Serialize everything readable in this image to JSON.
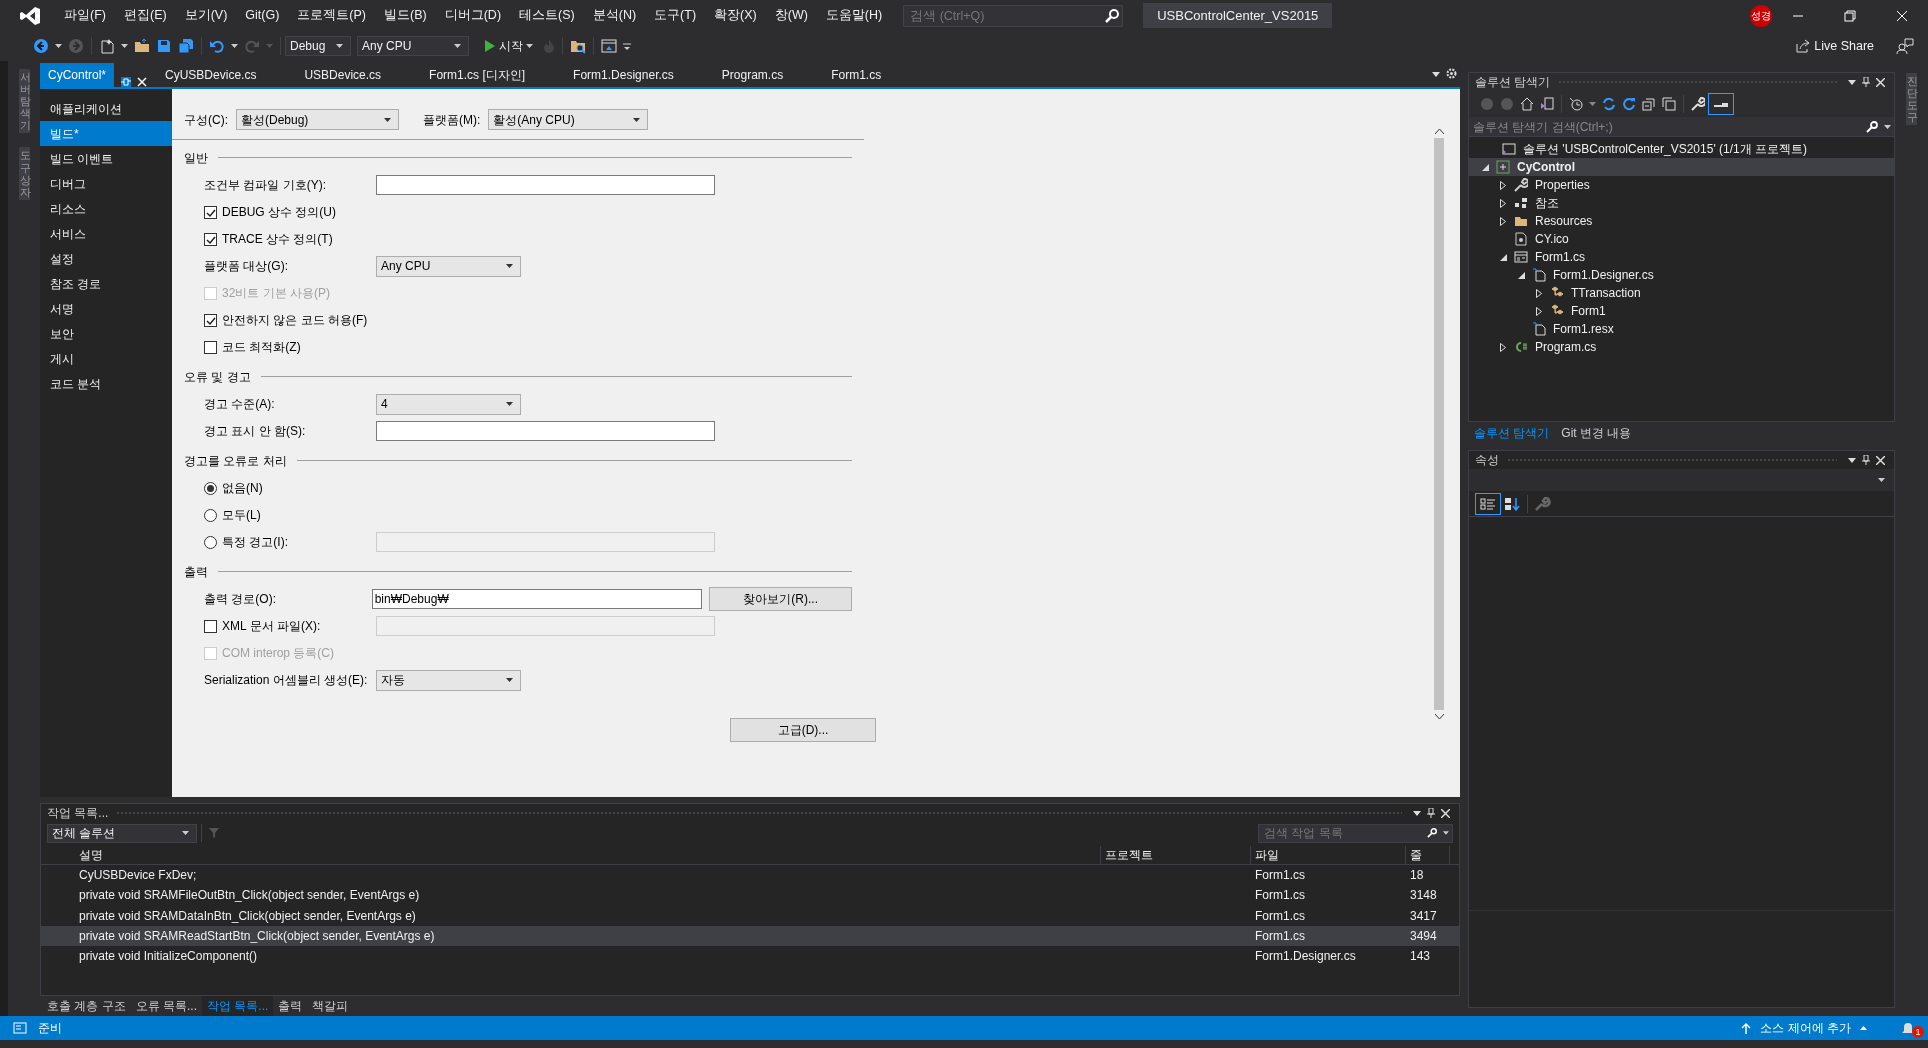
{
  "menu": [
    "파일(F)",
    "편집(E)",
    "보기(V)",
    "Git(G)",
    "프로젝트(P)",
    "빌드(B)",
    "디버그(D)",
    "테스트(S)",
    "분석(N)",
    "도구(T)",
    "확장(X)",
    "창(W)",
    "도움말(H)"
  ],
  "search": {
    "placeholder": "검색 (Ctrl+Q)"
  },
  "solution_name": "USBControlCenter_VS2015",
  "user_badge": "성경",
  "toolbar": {
    "configuration": "Debug",
    "platform": "Any CPU",
    "start": "시작"
  },
  "live_share": "Live Share",
  "tabs": [
    {
      "label": "CyControl*",
      "selected": true
    },
    {
      "label": "CyUSBDevice.cs",
      "selected": false
    },
    {
      "label": "USBDevice.cs",
      "selected": false
    },
    {
      "label": "Form1.cs [디자인]",
      "selected": false
    },
    {
      "label": "Form1.Designer.cs",
      "selected": false
    },
    {
      "label": "Program.cs",
      "selected": false
    },
    {
      "label": "Form1.cs",
      "selected": false
    }
  ],
  "left_strip": [
    "서버 탐색기",
    "도구 상자"
  ],
  "right_strip": [
    "진단 도구"
  ],
  "nav": [
    {
      "label": "애플리케이션",
      "selected": false
    },
    {
      "label": "빌드*",
      "selected": true
    },
    {
      "label": "빌드 이벤트",
      "selected": false
    },
    {
      "label": "디버그",
      "selected": false
    },
    {
      "label": "리소스",
      "selected": false
    },
    {
      "label": "서비스",
      "selected": false
    },
    {
      "label": "설정",
      "selected": false
    },
    {
      "label": "참조 경로",
      "selected": false
    },
    {
      "label": "서명",
      "selected": false
    },
    {
      "label": "보안",
      "selected": false
    },
    {
      "label": "게시",
      "selected": false
    },
    {
      "label": "코드 분석",
      "selected": false
    }
  ],
  "build": {
    "configuration": {
      "label": "구성(C):",
      "value": "활성(Debug)"
    },
    "platform": {
      "label": "플랫폼(M):",
      "value": "활성(Any CPU)"
    },
    "sections": [
      {
        "title": "일반",
        "rows": [
          {
            "kind": "field",
            "label": "조건부 컴파일 기호(Y):",
            "disabled": false
          },
          {
            "kind": "check",
            "label": "DEBUG 상수 정의(U)",
            "checked": true,
            "disabled": false
          },
          {
            "kind": "check",
            "label": "TRACE 상수 정의(T)",
            "checked": true,
            "disabled": false
          },
          {
            "kind": "select",
            "label": "플랫폼 대상(G):",
            "value": "Any CPU"
          },
          {
            "kind": "check",
            "label": "32비트 기본 사용(P)",
            "checked": false,
            "disabled": true
          },
          {
            "kind": "check",
            "label": "안전하지 않은 코드 허용(F)",
            "checked": true,
            "disabled": false
          },
          {
            "kind": "check",
            "label": "코드 최적화(Z)",
            "checked": false,
            "disabled": false
          }
        ]
      },
      {
        "title": "오류 및 경고",
        "rows": [
          {
            "kind": "select",
            "label": "경고 수준(A):",
            "value": "4"
          },
          {
            "kind": "field",
            "label": "경고 표시 안 함(S):",
            "disabled": false
          }
        ]
      },
      {
        "title": "경고를 오류로 처리",
        "rows": [
          {
            "kind": "radio",
            "label": "없음(N)",
            "selected": true
          },
          {
            "kind": "radio",
            "label": "모두(L)",
            "selected": false
          },
          {
            "kind": "radio",
            "label": "특정 경고(I):",
            "selected": false,
            "field": {
              "disabled": true
            }
          }
        ]
      },
      {
        "title": "출력",
        "rows": [
          {
            "kind": "field",
            "label": "출력 경로(O):",
            "value": "bin₩Debug₩",
            "disabled": false,
            "button": "찾아보기(R)..."
          },
          {
            "kind": "check",
            "label": "XML 문서 파일(X):",
            "checked": false,
            "disabled": false,
            "field": {
              "disabled": true
            }
          },
          {
            "kind": "check",
            "label": "COM interop 등록(C)",
            "checked": false,
            "disabled": true
          },
          {
            "kind": "select",
            "label": "Serialization 어셈블리 생성(E):",
            "value": "자동"
          }
        ]
      }
    ],
    "advanced_button": "고급(D)..."
  },
  "solution_explorer": {
    "title": "솔루션 탐색기",
    "search_placeholder": "솔루션 탐색기 검색(Ctrl+;)",
    "preview_on": true,
    "tree": [
      {
        "label": "솔루션 'USBControlCenter_VS2015' (1/1개 프로젝트)",
        "kind": "solution",
        "selected": false,
        "children": [
          {
            "label": "CyControl",
            "kind": "project",
            "expanded": true,
            "selected": true,
            "children": [
              {
                "label": "Properties",
                "kind": "wrench",
                "expanded": false,
                "selected": false
              },
              {
                "label": "참조",
                "kind": "references",
                "expanded": false,
                "selected": false
              },
              {
                "label": "Resources",
                "kind": "folder",
                "expanded": false,
                "selected": false
              },
              {
                "label": "CY.ico",
                "kind": "file",
                "selected": false
              },
              {
                "label": "Form1.cs",
                "kind": "form",
                "expanded": true,
                "selected": false,
                "children": [
                  {
                    "label": "Form1.Designer.cs",
                    "kind": "designer",
                    "expanded": true,
                    "selected": false,
                    "children": [
                      {
                        "label": "TTransaction",
                        "kind": "class",
                        "expanded": false,
                        "selected": false
                      },
                      {
                        "label": "Form1",
                        "kind": "class",
                        "expanded": false,
                        "selected": false
                      }
                    ]
                  },
                  {
                    "label": "Form1.resx",
                    "kind": "designer",
                    "selected": false
                  }
                ]
              },
              {
                "label": "Program.cs",
                "kind": "csharp",
                "expanded": false,
                "selected": false
              }
            ]
          }
        ]
      }
    ],
    "tabs": [
      {
        "label": "솔루션 탐색기",
        "selected": true
      },
      {
        "label": "Git 변경 내용",
        "selected": false
      }
    ]
  },
  "properties": {
    "title": "속성",
    "categorized_on": true
  },
  "task_list": {
    "title": "작업 목록...",
    "scope": "전체 솔루션",
    "search_placeholder": "검색 작업 목록",
    "columns": [
      "설명",
      "프로젝트",
      "파일",
      "줄"
    ],
    "rows": [
      {
        "cells": [
          "CyUSBDevice FxDev;",
          "",
          "Form1.cs",
          "18"
        ],
        "selected": false
      },
      {
        "cells": [
          "private void SRAMFileOutBtn_Click(object sender, EventArgs e)",
          "",
          "Form1.cs",
          "3148"
        ],
        "selected": false
      },
      {
        "cells": [
          "private void SRAMDataInBtn_Click(object sender, EventArgs e)",
          "",
          "Form1.cs",
          "3417"
        ],
        "selected": false
      },
      {
        "cells": [
          "private void SRAMReadStartBtn_Click(object sender, EventArgs e)",
          "",
          "Form1.cs",
          "3494"
        ],
        "selected": true
      },
      {
        "cells": [
          "private void InitializeComponent()",
          "",
          "Form1.Designer.cs",
          "143"
        ],
        "selected": false
      }
    ]
  },
  "bottom_tabs": [
    {
      "label": "호출 계층 구조",
      "selected": false
    },
    {
      "label": "오류 목록...",
      "selected": false
    },
    {
      "label": "작업 목록...",
      "selected": true
    },
    {
      "label": "출력",
      "selected": false
    },
    {
      "label": "책갈피",
      "selected": false
    }
  ],
  "status": {
    "text": "준비",
    "source_control": "소스 제어에 추가",
    "notifications": "1"
  }
}
